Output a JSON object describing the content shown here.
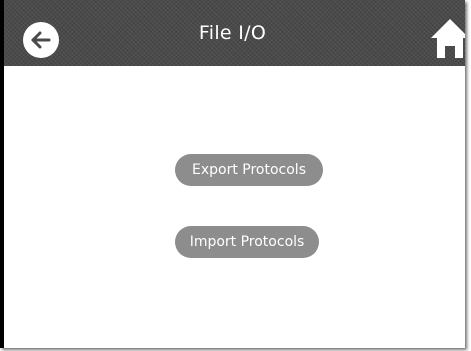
{
  "header": {
    "title": "File I/O"
  },
  "actions": {
    "export_label": "Export Protocols",
    "import_label": "Import Protocols"
  },
  "icons": {
    "back": "arrow-left-circle-icon",
    "home": "home-icon"
  },
  "colors": {
    "header_bg": "#4a4a4a",
    "button_bg": "#8d8d8d",
    "text_on_dark": "#ffffff"
  }
}
